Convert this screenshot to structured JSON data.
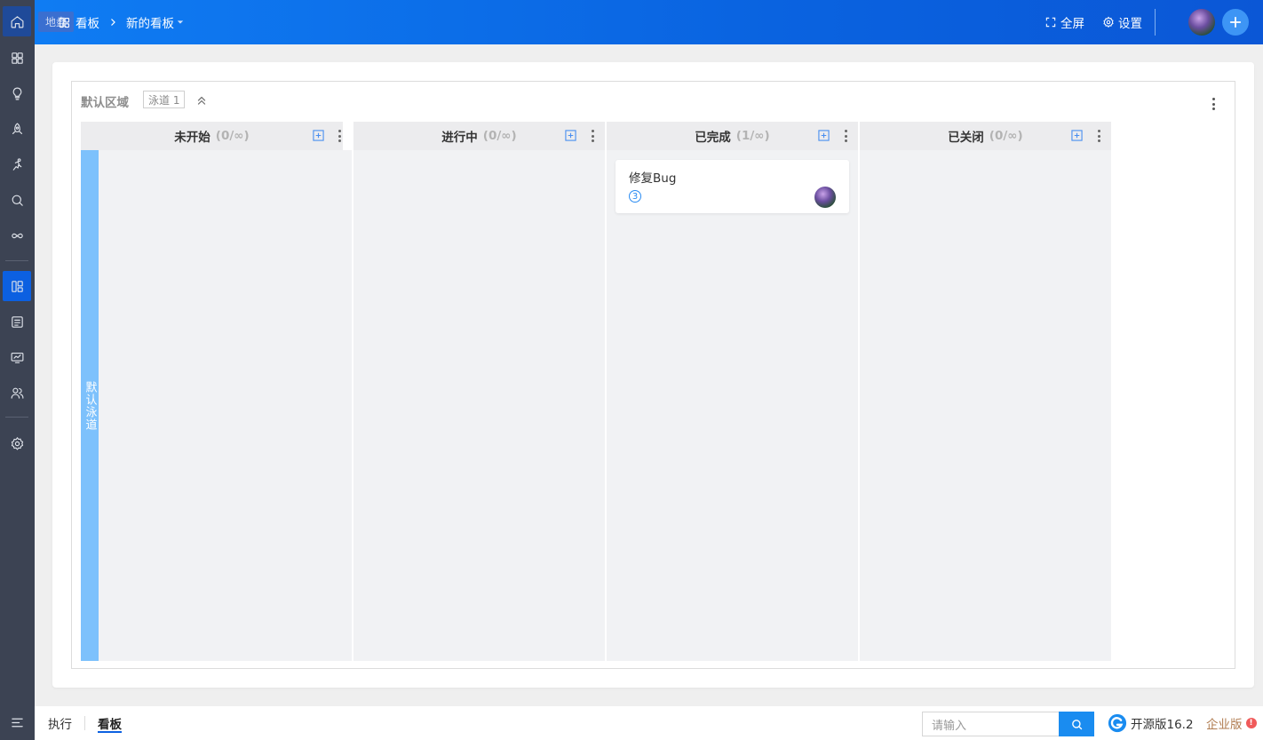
{
  "header": {
    "tooltip": "地盘",
    "breadcrumb_root": "看板",
    "breadcrumb_current": "新的看板",
    "fullscreen_label": "全屏",
    "settings_label": "设置"
  },
  "sidebar": {
    "items": [
      "home-icon",
      "grid-icon",
      "lightbulb-icon",
      "rocket-icon",
      "run-icon",
      "search-bug-icon",
      "infinity-icon",
      "kanban-icon",
      "list-icon",
      "monitor-icon",
      "users-icon",
      "gear-icon"
    ],
    "active": "kanban-icon"
  },
  "board": {
    "region_title": "默认区域",
    "lane_tag": "泳道 1",
    "lane_name": "默认泳道",
    "columns": [
      {
        "name": "未开始",
        "count": "(0/∞)"
      },
      {
        "name": "进行中",
        "count": "(0/∞)"
      },
      {
        "name": "已完成",
        "count": "(1/∞)"
      },
      {
        "name": "已关闭",
        "count": "(0/∞)"
      }
    ],
    "card": {
      "title": "修复Bug",
      "priority": "3"
    }
  },
  "footer": {
    "tab_execute": "执行",
    "tab_kanban": "看板",
    "search_placeholder": "请输入",
    "version": "开源版16.2",
    "enterprise": "企业版",
    "warn": "!"
  },
  "colors": {
    "accent": "#0c60e1",
    "lane": "#7dc1fc",
    "sidebar": "#3c4353"
  }
}
